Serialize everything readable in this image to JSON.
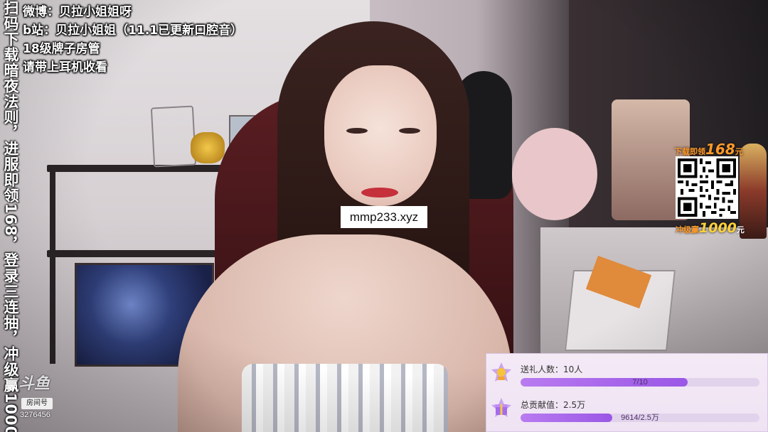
{
  "overlay": {
    "weibo_line": "微博：贝拉小姐姐呀",
    "bilibili_line": "b站：贝拉小姐姐（11.1已更新口腔音）",
    "fan_line": "18级牌子房管",
    "headphones_line": "请带上耳机收看",
    "vertical_ad": "扫码下载暗夜法则，进服即领168，登录三连抽，冲级赢1000",
    "watermark_url": "mmp233.xyz"
  },
  "branding": {
    "logo_text": "斗鱼",
    "room_tag": "房间号",
    "room_id": "3276456"
  },
  "ad": {
    "top_prefix": "下载即领",
    "top_amount": "168",
    "top_unit": "元",
    "bottom_prefix": "冲级赢",
    "bottom_amount": "1000",
    "bottom_unit": "元",
    "qr_icon": "qr-code-icon"
  },
  "gift_panel": {
    "givers_label": "送礼人数：10人",
    "givers_progress_text": "7/10",
    "givers_progress": 0.7,
    "contribution_label": "总贡献值：2.5万",
    "contribution_progress_text": "9614/2.5万",
    "contribution_progress": 0.3846,
    "icons": [
      "trophy-star-icon",
      "gift-box-icon"
    ],
    "accent_color": "#a565ec"
  }
}
